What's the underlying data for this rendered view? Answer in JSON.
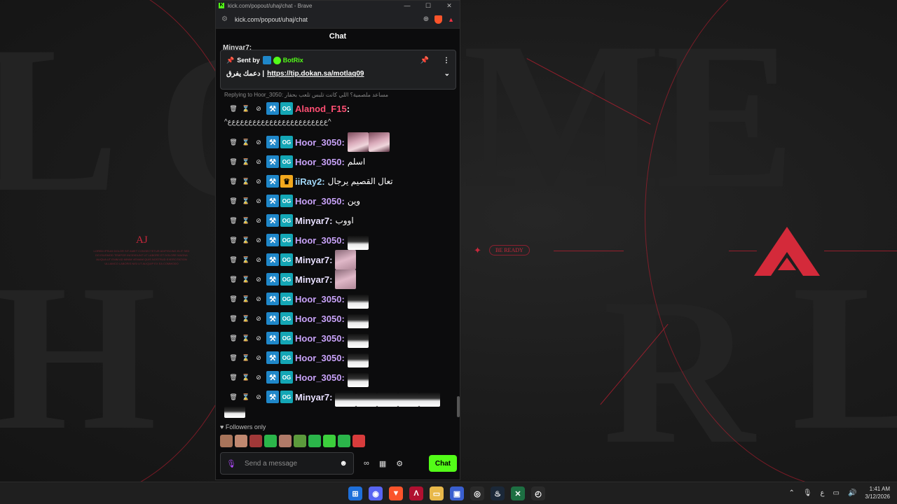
{
  "browser": {
    "title": "kick.com/popout/uhaj/chat - Brave",
    "url": "kick.com/popout/uhaj/chat",
    "logo_letter": "K"
  },
  "chat": {
    "header": "Chat",
    "peek_above": "Minyar7:",
    "pinned": {
      "sent_by_label": "Sent by",
      "bot_name": "BotRix",
      "message_prefix": "دعمك يفرق |",
      "link": "https://tip.dokan.sa/motlaq09"
    },
    "reply_line": "Replying to Hoor_3050: مساعد ملصمية؟ اللي كانت تلبس  تلعب بحفار",
    "first_message": {
      "user": "Alanod_F15",
      "colon": ":",
      "wrapped": "^ﻉﻉﻉﻉﻉﻉﻉﻉﻉﻉﻉﻉﻉﻉﻉﻉﻉﻉﻉﻉﻉﻉﻉﻉ^"
    },
    "messages": [
      {
        "user": "Hoor_3050:",
        "text": "",
        "color": "#c8a2f8",
        "emotes": "face2",
        "badge": "teal"
      },
      {
        "user": "Hoor_3050:",
        "text": "اسلم",
        "color": "#c8a2f8",
        "emotes": "",
        "badge": "teal"
      },
      {
        "user": "iiRay2:",
        "text": "تعال القصيم يرجال",
        "color": "#9fd5f5",
        "emotes": "",
        "badge": "crown"
      },
      {
        "user": "Hoor_3050:",
        "text": "وين",
        "color": "#c8a2f8",
        "emotes": "",
        "badge": "teal"
      },
      {
        "user": "Minyar7:",
        "text": "اووب",
        "color": "#e8e0ff",
        "emotes": "",
        "badge": "teal"
      },
      {
        "user": "Hoor_3050:",
        "text": "",
        "color": "#c8a2f8",
        "emotes": "dance1",
        "badge": "teal"
      },
      {
        "user": "Minyar7:",
        "text": "",
        "color": "#e8e0ff",
        "emotes": "pink",
        "badge": "teal"
      },
      {
        "user": "Minyar7:",
        "text": "",
        "color": "#e8e0ff",
        "emotes": "pink",
        "badge": "teal"
      },
      {
        "user": "Hoor_3050:",
        "text": "",
        "color": "#c8a2f8",
        "emotes": "dance1",
        "badge": "teal"
      },
      {
        "user": "Hoor_3050:",
        "text": "",
        "color": "#c8a2f8",
        "emotes": "dance1",
        "badge": "teal"
      },
      {
        "user": "Hoor_3050:",
        "text": "",
        "color": "#c8a2f8",
        "emotes": "dance1",
        "badge": "teal"
      },
      {
        "user": "Hoor_3050:",
        "text": "",
        "color": "#c8a2f8",
        "emotes": "dance1",
        "badge": "teal"
      },
      {
        "user": "Hoor_3050:",
        "text": "",
        "color": "#c8a2f8",
        "emotes": "dance1",
        "badge": "teal"
      },
      {
        "user": "Minyar7:",
        "text": "",
        "color": "#e8e0ff",
        "emotes": "dance5",
        "badge": "teal"
      }
    ],
    "badge_text": "OG",
    "followers_only": "Followers only",
    "input_placeholder": "Send a message",
    "send_label": "Chat"
  },
  "wallpaper": {
    "aj": "AJ",
    "be_ready": "BE READY",
    "aj_text": "LOREM IPSUM DOLOR SIT AMET CONSECTETUR ADIPISCING ELIT SED DO EIUSMOD TEMPOR INCIDIDUNT UT LABORE ET DOLORE MAGNA ALIQUA UT ENIM AD MINIM VENIAM QUIS NOSTRUD EXERCITATION ULLAMCO LABORIS NISI UT ALIQUIP EX EA COMMODO"
  },
  "taskbar": {
    "time": "1:41 AM",
    "date": "3/12/2026",
    "lang": "ع"
  },
  "colors": {
    "kick_green": "#53fc18",
    "alanod": "#ff4f73",
    "badge_blue": "#1f87c9",
    "badge_teal": "#14a6b5"
  }
}
